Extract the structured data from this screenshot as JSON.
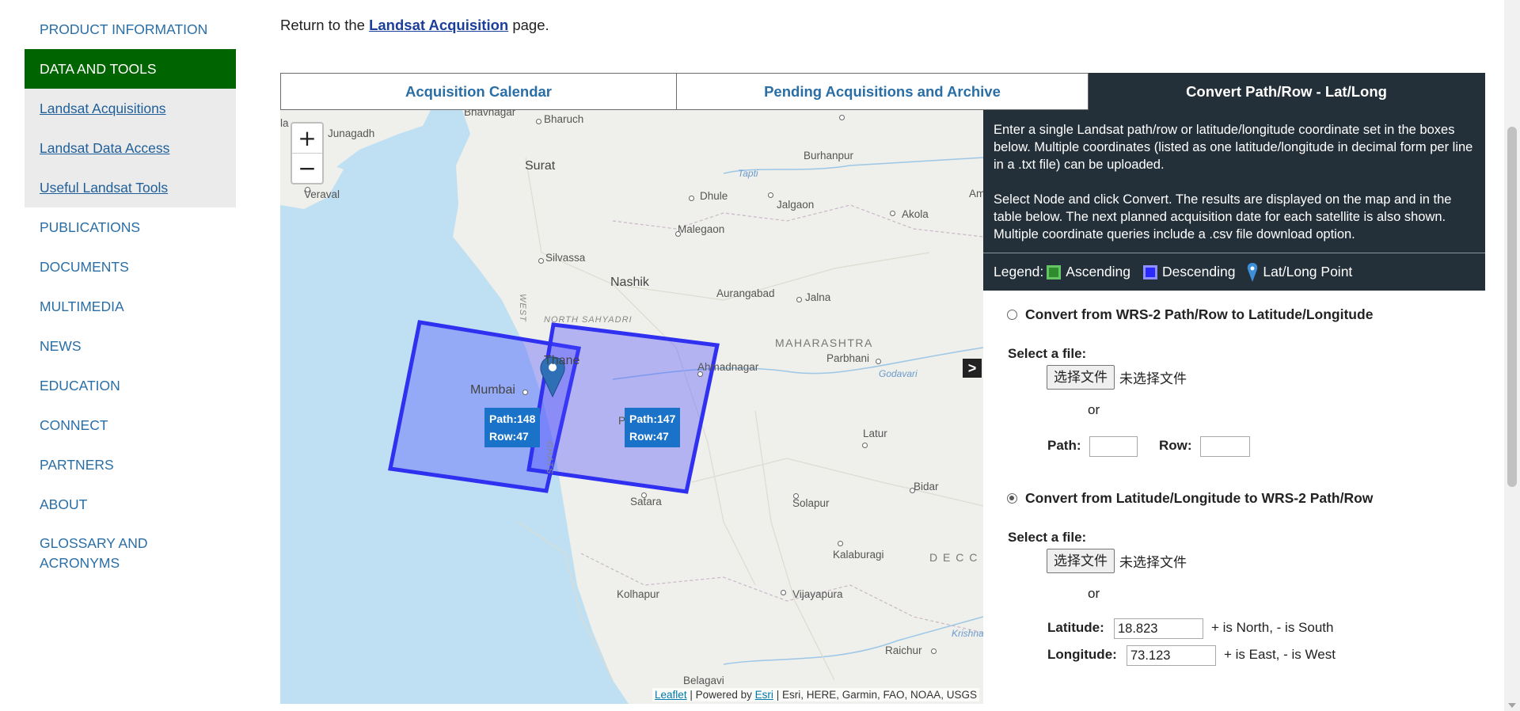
{
  "sidebar": {
    "items": [
      {
        "label": "PRODUCT INFORMATION"
      },
      {
        "label": "DATA AND TOOLS"
      },
      {
        "label": "Landsat Acquisitions"
      },
      {
        "label": "Landsat Data Access"
      },
      {
        "label": "Useful Landsat Tools"
      },
      {
        "label": "PUBLICATIONS"
      },
      {
        "label": "DOCUMENTS"
      },
      {
        "label": "MULTIMEDIA"
      },
      {
        "label": "NEWS"
      },
      {
        "label": "EDUCATION"
      },
      {
        "label": "CONNECT"
      },
      {
        "label": "PARTNERS"
      },
      {
        "label": "ABOUT"
      },
      {
        "label": "GLOSSARY AND"
      },
      {
        "label": "ACRONYMS"
      }
    ]
  },
  "return_line": {
    "prefix": "Return to the",
    "link": "Landsat Acquisition",
    "suffix": "page."
  },
  "tabs": [
    {
      "label": "Acquisition Calendar"
    },
    {
      "label": "Pending Acquisitions and Archive"
    },
    {
      "label": "Convert Path/Row - Lat/Long"
    }
  ],
  "map": {
    "zoom_in": "+",
    "zoom_out": "−",
    "collapse": ">",
    "footprints": [
      {
        "path": "Path:148",
        "row": "Row:47"
      },
      {
        "path": "Path:147",
        "row": "Row:47"
      }
    ],
    "cities": [
      {
        "name": "Bhavnagar"
      },
      {
        "name": "Bharuch"
      },
      {
        "name": "Junagadh"
      },
      {
        "name": "Surat"
      },
      {
        "name": "Veraval"
      },
      {
        "name": "Burhanpur"
      },
      {
        "name": "Tapti"
      },
      {
        "name": "Dhule"
      },
      {
        "name": "Jalgaon"
      },
      {
        "name": "Akola"
      },
      {
        "name": "Malegaon"
      },
      {
        "name": "Silvassa"
      },
      {
        "name": "Nashik"
      },
      {
        "name": "Aurangabad"
      },
      {
        "name": "Jalna"
      },
      {
        "name": "NORTH SAHYADRI"
      },
      {
        "name": "MAHARASHTRA"
      },
      {
        "name": "Thane"
      },
      {
        "name": "Ahmadnagar"
      },
      {
        "name": "Parbhani"
      },
      {
        "name": "Godavari"
      },
      {
        "name": "Mumbai"
      },
      {
        "name": "Latur"
      },
      {
        "name": "Bidar"
      },
      {
        "name": "Satara"
      },
      {
        "name": "Solapur"
      },
      {
        "name": "Kalaburagi"
      },
      {
        "name": "D E C C"
      },
      {
        "name": "Kolhapur"
      },
      {
        "name": "Vijayapura"
      },
      {
        "name": "Krishna"
      },
      {
        "name": "Raichur"
      },
      {
        "name": "Belagavi"
      },
      {
        "name": "Am"
      },
      {
        "name": "WEST"
      },
      {
        "name": "GHATS"
      },
      {
        "name": "la"
      },
      {
        "name": "P"
      }
    ],
    "attribution": {
      "leaflet": "Leaflet",
      "powered": "| Powered by",
      "esri": "Esri",
      "rest": "| Esri, HERE, Garmin, FAO, NOAA, USGS"
    }
  },
  "panel": {
    "desc1": "Enter a single Landsat path/row or latitude/longitude coordinate set in the boxes below. Multiple coordinates (listed as one latitude/longitude in decimal form per line in a .txt file) can be uploaded.",
    "desc2": "Select Node and click Convert. The results are displayed on the map and in the table below. The next planned acquisition date for each satellite is also shown. Multiple coordinate queries include a .csv file download option.",
    "legend": {
      "label": "Legend:",
      "ascending": "Ascending",
      "descending": "Descending",
      "point": "Lat/Long Point",
      "colors": {
        "ascending": "#2e8b2e",
        "descending": "#2a2aff"
      }
    },
    "section1": {
      "title": "Convert from WRS-2 Path/Row to Latitude/Longitude",
      "select_file": "Select a file:",
      "choose_btn": "选择文件",
      "no_file": "未选择文件",
      "or": "or",
      "path_label": "Path:",
      "row_label": "Row:",
      "path_value": "",
      "row_value": ""
    },
    "section2": {
      "title": "Convert from Latitude/Longitude to WRS-2 Path/Row",
      "select_file": "Select a file:",
      "choose_btn": "选择文件",
      "no_file": "未选择文件",
      "or": "or",
      "lat_label": "Latitude:",
      "lat_value": "18.823",
      "lat_hint": "+ is North, - is South",
      "lon_label": "Longitude:",
      "lon_value": "73.123",
      "lon_hint": "+ is East, - is West"
    }
  }
}
